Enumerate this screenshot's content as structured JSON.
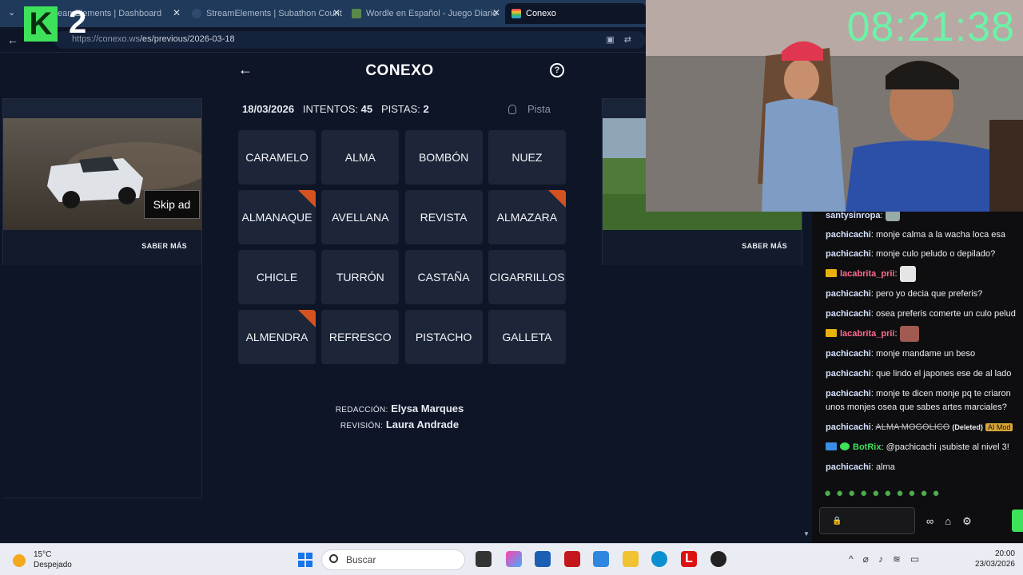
{
  "browser": {
    "tabs": [
      {
        "label": "StreamElements | Dashboard"
      },
      {
        "label": "StreamElements | Subathon Count"
      },
      {
        "label": "Wordle en Español - Juego Diario"
      },
      {
        "label": "Conexo"
      }
    ],
    "url_host": "https://conexo.ws",
    "url_path": "/es/previous/2026-03-18"
  },
  "ads": {
    "saber_mas": "SABER MÁS",
    "skip": "Skip ad"
  },
  "game": {
    "title": "CONEXO",
    "date": "18/03/2026",
    "attempts_label": "INTENTOS:",
    "attempts": "45",
    "hints_label": "PISTAS:",
    "hints": "2",
    "hint_button": "Pista",
    "words": [
      {
        "text": "CARAMELO",
        "flag": false
      },
      {
        "text": "ALMA",
        "flag": false
      },
      {
        "text": "BOMBÓN",
        "flag": false
      },
      {
        "text": "NUEZ",
        "flag": false
      },
      {
        "text": "ALMANAQUE",
        "flag": true
      },
      {
        "text": "AVELLANA",
        "flag": false
      },
      {
        "text": "REVISTA",
        "flag": false
      },
      {
        "text": "ALMAZARA",
        "flag": true
      },
      {
        "text": "CHICLE",
        "flag": false
      },
      {
        "text": "TURRÓN",
        "flag": false
      },
      {
        "text": "CASTAÑA",
        "flag": false
      },
      {
        "text": "CIGARRILLOS",
        "flag": false
      },
      {
        "text": "ALMENDRA",
        "flag": true
      },
      {
        "text": "REFRESCO",
        "flag": false
      },
      {
        "text": "PISTACHO",
        "flag": false
      },
      {
        "text": "GALLETA",
        "flag": false
      }
    ],
    "flag_color": "#d4521f",
    "credits": {
      "redaccion_label": "REDACCIÓN:",
      "redaccion": "Elysa Marques",
      "revision_label": "REVISIÓN:",
      "revision": "Laura Andrade"
    }
  },
  "overlay": {
    "timer": "08:21:38",
    "logo_letter": "K",
    "logo_number": "2"
  },
  "chat": {
    "messages": [
      {
        "user": "santysinropa",
        "text": ""
      },
      {
        "user": "pachicachi",
        "text": "monje calma a la wacha loca esa"
      },
      {
        "user": "pachicachi",
        "text": "monje culo peludo o depilado?"
      },
      {
        "user": "lacabrita_prii",
        "text": ""
      },
      {
        "user": "pachicachi",
        "text": "pero yo decia que preferis?"
      },
      {
        "user": "pachicachi",
        "text": "osea preferis comerte un culo pelud"
      },
      {
        "user": "lacabrita_prii",
        "text": ""
      },
      {
        "user": "pachicachi",
        "text": "monje mandame un beso"
      },
      {
        "user": "pachicachi",
        "text": "que lindo el japones ese de al lado"
      },
      {
        "user": "pachicachi",
        "text": "monje te dicen monje pq te criaron"
      },
      {
        "user": "",
        "text": "unos monjes osea que sabes artes marciales?"
      },
      {
        "user": "pachicachi",
        "text": "ALMA MOGOLICO"
      },
      {
        "user": "BotRix",
        "text": "@pachicachi ¡subiste al nivel 3!"
      },
      {
        "user": "pachicachi",
        "text": "alma"
      }
    ],
    "deleted_label": "(Deleted)",
    "mod_badge": "AI Mod"
  },
  "taskbar": {
    "temperature": "15°C",
    "condition": "Despejado",
    "search_placeholder": "Buscar",
    "time": "20:00",
    "date": "23/03/2026"
  }
}
